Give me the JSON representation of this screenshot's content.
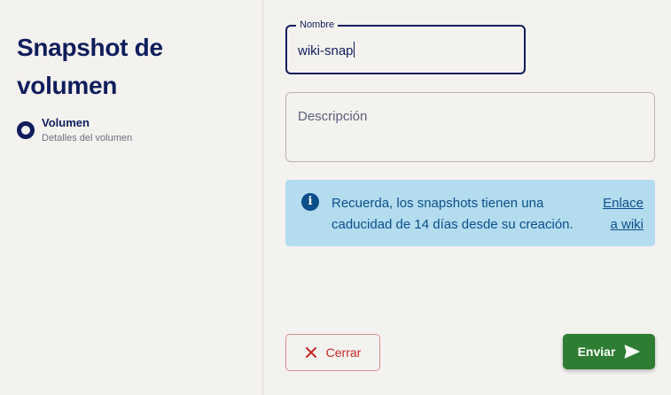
{
  "sidebar": {
    "title": "Snapshot de volumen",
    "steps": [
      {
        "title": "Volumen",
        "subtitle": "Detalles del volumen"
      }
    ]
  },
  "form": {
    "name_label": "Nombre",
    "name_value": "wiki-snap",
    "description_placeholder": "Descripción"
  },
  "info": {
    "text": "Recuerda, los snapshots tienen una caducidad de 14 días desde su creación.",
    "link": "Enlace a wiki",
    "icon": "info-icon"
  },
  "actions": {
    "close_label": "Cerrar",
    "close_icon": "close-icon",
    "submit_label": "Enviar",
    "submit_icon": "send-icon"
  },
  "colors": {
    "primary": "#0f1d5c",
    "danger": "#c62828",
    "success": "#2e7d32",
    "info_bg": "#b3dcef",
    "info_text": "#0b4f8a"
  }
}
